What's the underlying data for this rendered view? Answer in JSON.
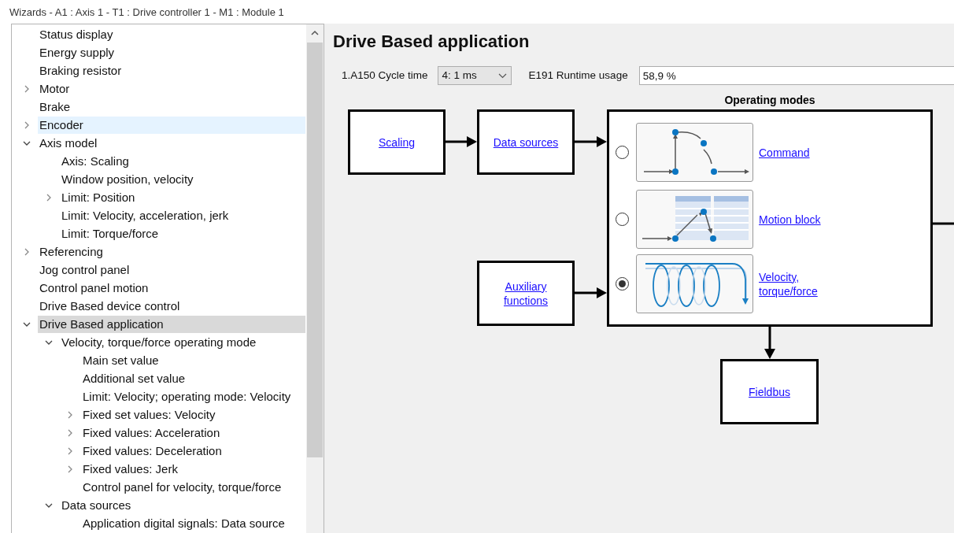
{
  "window": {
    "title": "Wizards - A1 : Axis 1 - T1 : Drive controller 1 - M1 : Module 1"
  },
  "tree": [
    {
      "label": "Status display",
      "kind": "leaf",
      "selected": false,
      "hovered": false
    },
    {
      "label": "Energy supply",
      "kind": "leaf",
      "selected": false,
      "hovered": false
    },
    {
      "label": "Braking resistor",
      "kind": "leaf",
      "selected": false,
      "hovered": false
    },
    {
      "label": "Motor",
      "kind": "group",
      "expanded": false,
      "selected": false,
      "hovered": false
    },
    {
      "label": "Brake",
      "kind": "leaf",
      "selected": false,
      "hovered": false
    },
    {
      "label": "Encoder",
      "kind": "group",
      "expanded": false,
      "selected": false,
      "hovered": true
    },
    {
      "label": "Axis model",
      "kind": "group",
      "expanded": true,
      "selected": false,
      "hovered": false,
      "children": [
        {
          "label": "Axis: Scaling",
          "kind": "leaf",
          "selected": false,
          "hovered": false
        },
        {
          "label": "Window position, velocity",
          "kind": "leaf",
          "selected": false,
          "hovered": false
        },
        {
          "label": "Limit: Position",
          "kind": "group",
          "expanded": false,
          "selected": false,
          "hovered": false
        },
        {
          "label": "Limit: Velocity, acceleration, jerk",
          "kind": "leaf",
          "selected": false,
          "hovered": false
        },
        {
          "label": "Limit: Torque/force",
          "kind": "leaf",
          "selected": false,
          "hovered": false
        }
      ]
    },
    {
      "label": "Referencing",
      "kind": "group",
      "expanded": false,
      "selected": false,
      "hovered": false
    },
    {
      "label": "Jog control panel",
      "kind": "leaf",
      "selected": false,
      "hovered": false
    },
    {
      "label": "Control panel motion",
      "kind": "leaf",
      "selected": false,
      "hovered": false
    },
    {
      "label": "Drive Based device control",
      "kind": "leaf",
      "selected": false,
      "hovered": false
    },
    {
      "label": "Drive Based application",
      "kind": "group",
      "expanded": true,
      "selected": true,
      "hovered": false,
      "children": [
        {
          "label": "Velocity, torque/force operating mode",
          "kind": "group",
          "expanded": true,
          "selected": false,
          "hovered": false,
          "children": [
            {
              "label": "Main set value",
              "kind": "leaf",
              "selected": false,
              "hovered": false
            },
            {
              "label": "Additional set value",
              "kind": "leaf",
              "selected": false,
              "hovered": false
            },
            {
              "label": "Limit: Velocity; operating mode: Velocity",
              "kind": "leaf",
              "selected": false,
              "hovered": false
            },
            {
              "label": "Fixed set values: Velocity",
              "kind": "group",
              "expanded": false,
              "selected": false,
              "hovered": false
            },
            {
              "label": "Fixed values: Acceleration",
              "kind": "group",
              "expanded": false,
              "selected": false,
              "hovered": false
            },
            {
              "label": "Fixed values: Deceleration",
              "kind": "group",
              "expanded": false,
              "selected": false,
              "hovered": false
            },
            {
              "label": "Fixed values: Jerk",
              "kind": "group",
              "expanded": false,
              "selected": false,
              "hovered": false
            },
            {
              "label": "Control panel for velocity, torque/force",
              "kind": "leaf",
              "selected": false,
              "hovered": false
            }
          ]
        },
        {
          "label": "Data sources",
          "kind": "group",
          "expanded": true,
          "selected": false,
          "hovered": false,
          "children": [
            {
              "label": "Application digital signals: Data source",
              "kind": "leaf",
              "selected": false,
              "hovered": false
            }
          ]
        }
      ]
    }
  ],
  "page": {
    "title": "Drive Based application",
    "cycle_time": {
      "label": "1.A150 Cycle time",
      "value": "4: 1 ms"
    },
    "runtime": {
      "label": "E191 Runtime usage",
      "value": "58,9 %"
    }
  },
  "diagram": {
    "scaling": "Scaling",
    "data_sources": "Data sources",
    "auxiliary": "Auxiliary functions",
    "fieldbus": "Fieldbus",
    "operating_modes": {
      "title": "Operating modes",
      "modes": [
        {
          "kind": "command",
          "label": "Command",
          "selected": false
        },
        {
          "kind": "block",
          "label": "Motion block",
          "selected": false
        },
        {
          "kind": "velocity",
          "label": "Velocity, torque/force",
          "selected": true
        }
      ]
    }
  }
}
